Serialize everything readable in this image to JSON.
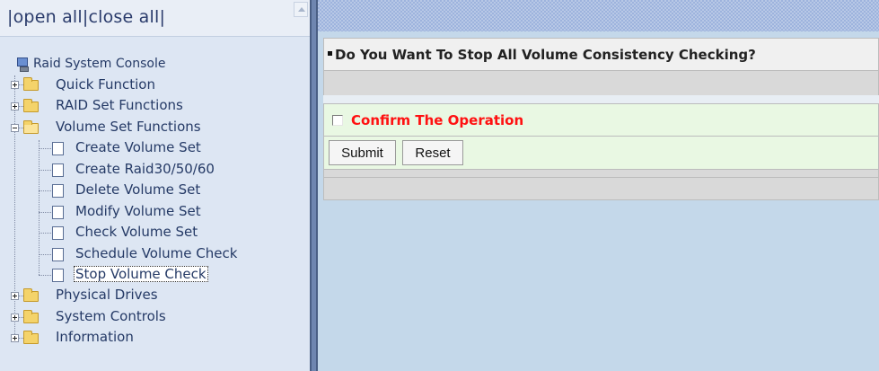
{
  "left_frame": {
    "open_all": "open all",
    "close_all": "close all",
    "separator": "|",
    "tree": {
      "root": "Raid System Console",
      "items": [
        {
          "label": "Quick Function",
          "type": "folder",
          "expanded": false
        },
        {
          "label": "RAID Set Functions",
          "type": "folder",
          "expanded": false
        },
        {
          "label": "Volume Set Functions",
          "type": "folder",
          "expanded": true,
          "children": [
            {
              "label": "Create Volume Set"
            },
            {
              "label": "Create Raid30/50/60"
            },
            {
              "label": "Delete Volume Set"
            },
            {
              "label": "Modify Volume Set"
            },
            {
              "label": "Check Volume Set"
            },
            {
              "label": "Schedule Volume Check"
            },
            {
              "label": "Stop Volume Check",
              "selected": true
            }
          ]
        },
        {
          "label": "Physical Drives",
          "type": "folder",
          "expanded": false
        },
        {
          "label": "System Controls",
          "type": "folder",
          "expanded": false
        },
        {
          "label": "Information",
          "type": "folder",
          "expanded": false
        }
      ]
    }
  },
  "main": {
    "title": "Do You Want To Stop All Volume Consistency Checking?",
    "confirm_label": "Confirm The Operation",
    "confirm_checked": false,
    "submit_label": "Submit",
    "reset_label": "Reset"
  },
  "colors": {
    "confirm_text": "#ff1111",
    "form_band": "#e9f8e3",
    "sidebar_bg": "#dde6f3",
    "right_bg": "#c4d8ea",
    "divider": "#4a5f85"
  }
}
